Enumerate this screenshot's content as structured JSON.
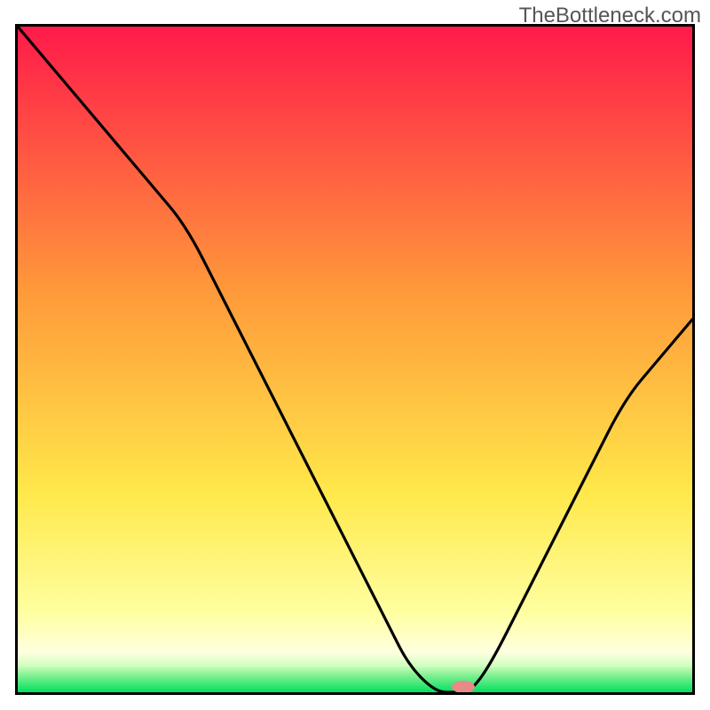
{
  "watermark": "TheBottleneck.com",
  "colors": {
    "top": "#ff1a4a",
    "upper_mid": "#ff6a3a",
    "mid": "#ffc23a",
    "lower_mid": "#ffe84a",
    "pale_yellow": "#ffffa0",
    "green_band_light": "#b6ffb0",
    "green": "#00e060",
    "marker": "#e88a88",
    "border": "#000000"
  },
  "chart_data": {
    "type": "line",
    "title": "",
    "xlabel": "",
    "ylabel": "",
    "xlim": [
      0,
      100
    ],
    "ylim": [
      0,
      100
    ],
    "x": [
      0,
      5,
      10,
      15,
      20,
      25,
      30,
      35,
      40,
      45,
      50,
      55,
      58,
      62,
      65,
      67,
      70,
      75,
      80,
      85,
      90,
      95,
      100
    ],
    "values": [
      100,
      94,
      88,
      82,
      76,
      70,
      60,
      50,
      40,
      30,
      20,
      10,
      4,
      0,
      0,
      0,
      4,
      14,
      24,
      34,
      44,
      50,
      56
    ],
    "marker": {
      "x": 66,
      "y": 0
    },
    "gradient_bands": [
      {
        "stop": 0,
        "desc": "red"
      },
      {
        "stop": 40,
        "desc": "orange"
      },
      {
        "stop": 70,
        "desc": "yellow"
      },
      {
        "stop": 92,
        "desc": "pale-yellow"
      },
      {
        "stop": 97,
        "desc": "light-green"
      },
      {
        "stop": 100,
        "desc": "green"
      }
    ]
  }
}
